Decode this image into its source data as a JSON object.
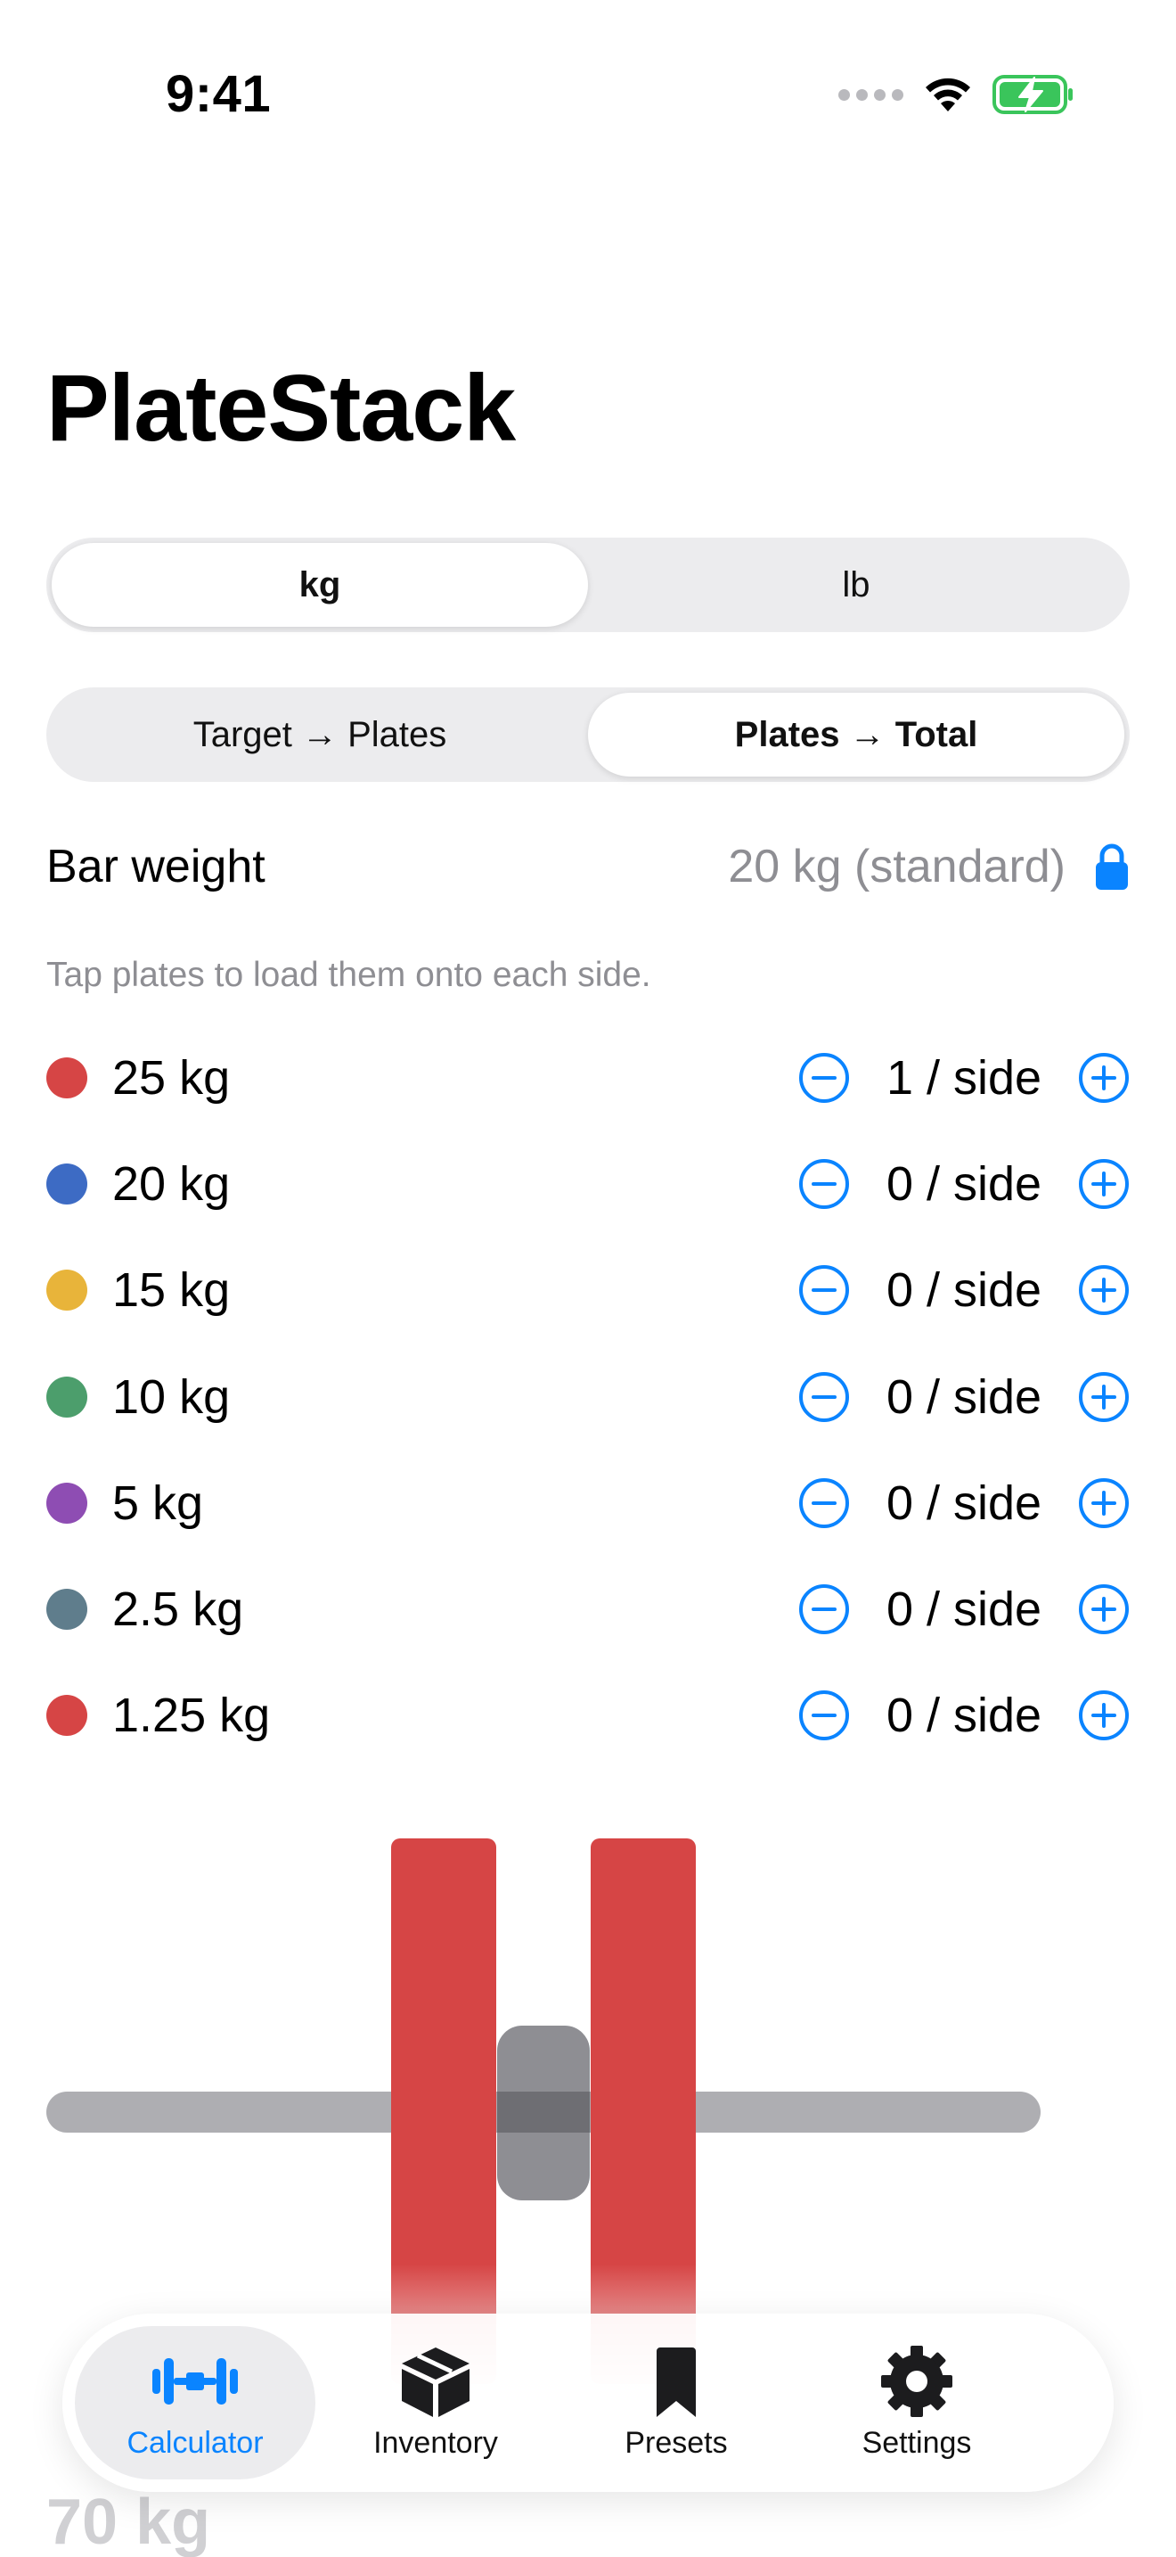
{
  "status_bar": {
    "time": "9:41"
  },
  "app": {
    "title": "PlateStack"
  },
  "units": {
    "options": [
      "kg",
      "lb"
    ],
    "selected": "kg"
  },
  "mode": {
    "options": [
      "Target → Plates",
      "Plates → Total"
    ],
    "selected": "Plates → Total"
  },
  "bar_weight": {
    "label": "Bar weight",
    "value": "20 kg (standard)"
  },
  "hint": "Tap plates to load them onto each side.",
  "plates": [
    {
      "label": "25 kg",
      "count": "1 / side",
      "color": "#d64545"
    },
    {
      "label": "20 kg",
      "count": "0 / side",
      "color": "#3d6bc4"
    },
    {
      "label": "15 kg",
      "count": "0 / side",
      "color": "#e8b43a"
    },
    {
      "label": "10 kg",
      "count": "0 / side",
      "color": "#4c9e6c"
    },
    {
      "label": "5 kg",
      "count": "0 / side",
      "color": "#8e4db3"
    },
    {
      "label": "2.5 kg",
      "count": "0 / side",
      "color": "#5f7d8c"
    },
    {
      "label": "1.25 kg",
      "count": "0 / side",
      "color": "#d64545"
    }
  ],
  "total": "70 kg",
  "tabs": [
    {
      "label": "Calculator",
      "icon": "barbell-icon",
      "active": true
    },
    {
      "label": "Inventory",
      "icon": "box-icon",
      "active": false
    },
    {
      "label": "Presets",
      "icon": "bookmark-icon",
      "active": false
    },
    {
      "label": "Settings",
      "icon": "gear-icon",
      "active": false
    }
  ],
  "colors": {
    "accent": "#0a84ff",
    "plate_loaded": "#d64545",
    "bar": "#aeaeb2",
    "secondary_text": "#8e8e93"
  }
}
